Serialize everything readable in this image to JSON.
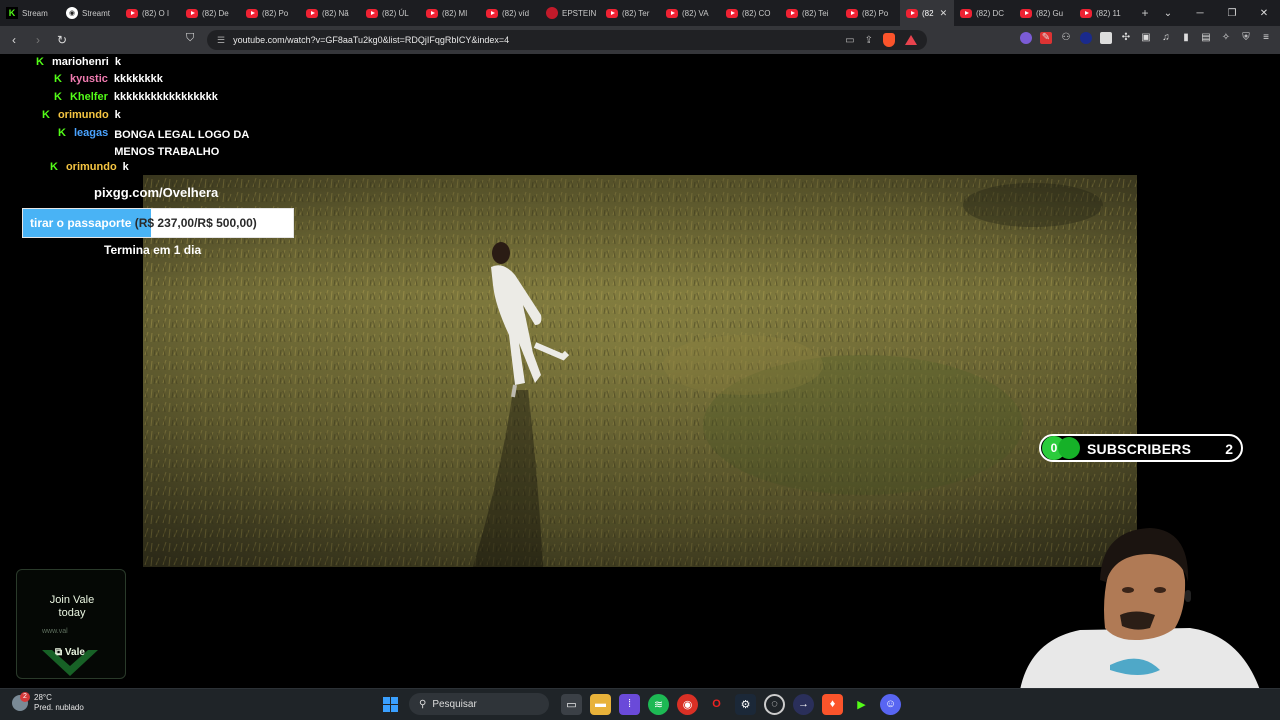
{
  "browser": {
    "tabs": [
      {
        "label": "Stream",
        "icon": "kick-icon"
      },
      {
        "label": "Streamt",
        "icon": "steam-icon"
      },
      {
        "label": "(82) O I",
        "icon": "youtube-icon"
      },
      {
        "label": "(82) De",
        "icon": "youtube-icon"
      },
      {
        "label": "(82) Po",
        "icon": "youtube-icon"
      },
      {
        "label": "(82) Nã",
        "icon": "youtube-icon"
      },
      {
        "label": "(82) ÚL",
        "icon": "youtube-icon"
      },
      {
        "label": "(82) MI",
        "icon": "youtube-icon"
      },
      {
        "label": "(82) víd",
        "icon": "youtube-icon"
      },
      {
        "label": "EPSTEIN",
        "icon": "red-circle-icon"
      },
      {
        "label": "(82) Ter",
        "icon": "youtube-icon"
      },
      {
        "label": "(82) VA",
        "icon": "youtube-icon"
      },
      {
        "label": "(82) CO",
        "icon": "youtube-icon"
      },
      {
        "label": "(82) Tei",
        "icon": "youtube-icon"
      },
      {
        "label": "(82) Po",
        "icon": "youtube-icon"
      },
      {
        "label": "(82",
        "icon": "youtube-icon",
        "active": true
      },
      {
        "label": "(82) DC",
        "icon": "youtube-icon"
      },
      {
        "label": "(82) Gu",
        "icon": "youtube-icon"
      },
      {
        "label": "(82) 11",
        "icon": "youtube-icon"
      }
    ],
    "url": "youtube.com/watch?v=GF8aaTu2kg0&list=RDQjIFqgRbICY&index=4"
  },
  "chat": {
    "messages": [
      {
        "user": "mariohenri",
        "text": "k",
        "user_color": "#ffffff"
      },
      {
        "user": "kyustic",
        "text": "kkkkkkkk",
        "user_color": "#f07bb0"
      },
      {
        "user": "Khelfer",
        "text": "kkkkkkkkkkkkkkkkk",
        "user_color": "#53fc18"
      },
      {
        "user": "orimundo",
        "text": "k",
        "user_color": "#f5c542"
      },
      {
        "user": "leagas",
        "text": "BONGA LEGAL LOGO DA",
        "text2": "MENOS TRABALHO",
        "user_color": "#4aa3ff"
      },
      {
        "user": "orimundo",
        "text": "k",
        "user_color": "#f5c542"
      }
    ]
  },
  "goal": {
    "link": "pixgg.com/Ovelhera",
    "name": "tirar o passaporte",
    "amount": "(R$ 237,00/R$ 500,00)",
    "progress": 0.474,
    "ends": "Termina em 1 dia"
  },
  "subscribers": {
    "count_badge": "0",
    "label": "SUBSCRIBERS",
    "value": "2"
  },
  "ad": {
    "line1": "Join Vale",
    "line2": "today",
    "url": "www.val",
    "brand": "Vale"
  },
  "taskbar": {
    "weather_temp": "28°C",
    "weather_desc": "Pred. nublado",
    "weather_badge": "2",
    "search_placeholder": "Pesquisar"
  }
}
